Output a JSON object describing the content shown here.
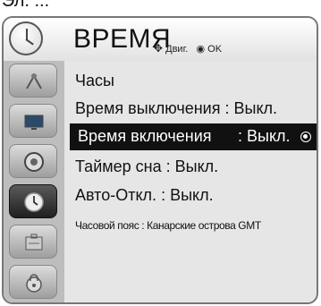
{
  "page_top_text": "Эл. ...",
  "menu": {
    "title": "ВРЕМЯ",
    "hint": {
      "nav_label": "Двиг.",
      "ok_label": "OK"
    },
    "categories": [
      {
        "name": "antenna-icon"
      },
      {
        "name": "picture-icon"
      },
      {
        "name": "audio-icon"
      },
      {
        "name": "time-icon",
        "active": true
      },
      {
        "name": "options-icon"
      },
      {
        "name": "lock-icon"
      }
    ],
    "items": {
      "clock": {
        "label": "Часы"
      },
      "off_time": {
        "label": "Время выключения",
        "sep": ":",
        "value": "Выкл."
      },
      "on_time": {
        "label": "Время включения",
        "sep": ":",
        "value": "Выкл."
      },
      "sleep_timer": {
        "label": "Таймер сна",
        "sep": ":",
        "value": "Выкл."
      },
      "auto_off": {
        "label": "Авто-Откл.",
        "sep": ":",
        "value": "Выкл."
      },
      "timezone": {
        "label": "Часовой пояс",
        "sep": ":",
        "value": "Канарские острова GMT"
      }
    }
  }
}
